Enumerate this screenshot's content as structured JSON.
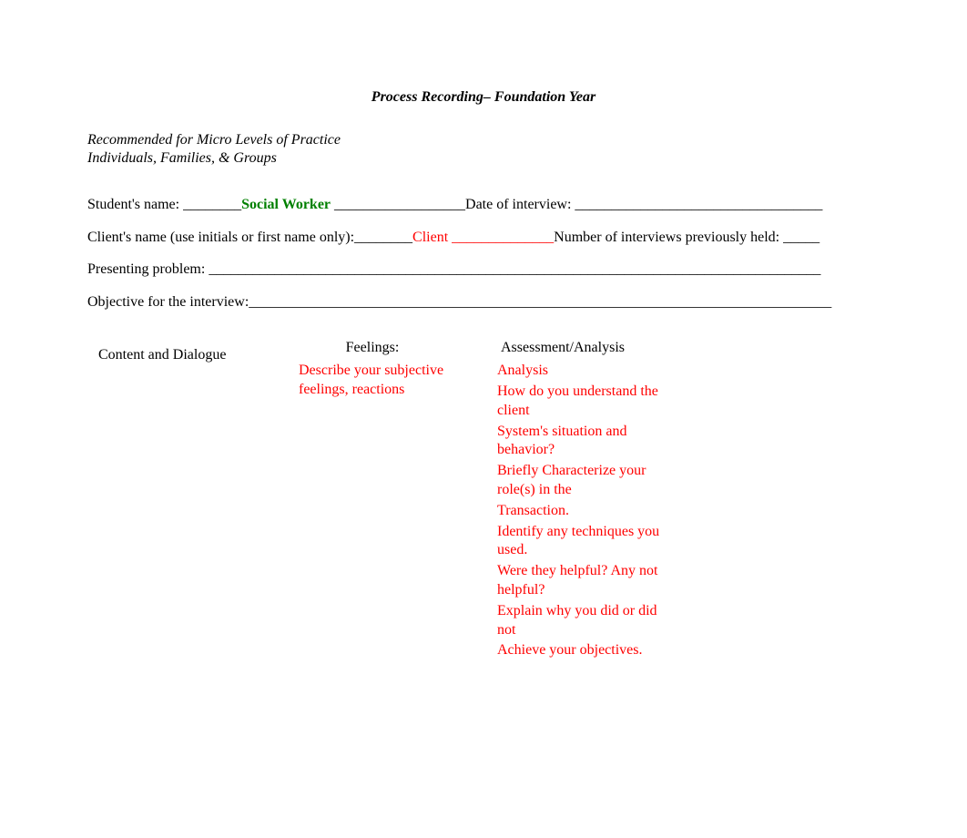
{
  "title": "Process Recording– Foundation Year",
  "recommended": {
    "line1": "Recommended for Micro Levels of Practice",
    "line2": "Individuals, Families, & Groups"
  },
  "fields": {
    "student_label": "Student's name: ________",
    "student_value": "Social Worker",
    "student_after": " __________________",
    "date_label": "Date of interview: __________________________________",
    "client_label": "Client's name (use initials or first name only):________",
    "client_value": "Client ______________",
    "num_interviews": "Number of interviews previously held: _____",
    "presenting": "Presenting problem:  ____________________________________________________________________________________",
    "objective": "Objective for the interview:________________________________________________________________________________"
  },
  "table": {
    "col1_header": "Content and Dialogue",
    "col2_header": "Feelings:",
    "col2_body": "Describe your subjective feelings, reactions",
    "col3_header": " Assessment/Analysis",
    "col3": {
      "p1": "Analysis",
      "p2": "How do you understand the client",
      "p3": "System's situation and behavior?",
      "p4": "Briefly Characterize your role(s) in the",
      "p5": "Transaction.",
      "p6": "Identify any techniques you used.",
      "p7": "Were they helpful? Any not helpful?",
      "p8": "Explain why you did or did not",
      "p9": "Achieve your objectives."
    }
  }
}
